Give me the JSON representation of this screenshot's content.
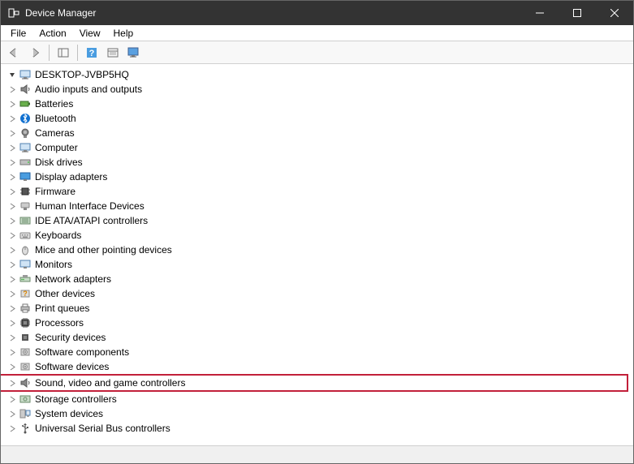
{
  "window": {
    "title": "Device Manager"
  },
  "menu": {
    "items": [
      "File",
      "Action",
      "View",
      "Help"
    ]
  },
  "toolbar": {
    "buttons": [
      {
        "name": "back",
        "icon": "arrow-left"
      },
      {
        "name": "forward",
        "icon": "arrow-right"
      },
      {
        "name": "show-hide-tree",
        "icon": "panel"
      },
      {
        "name": "help",
        "icon": "help"
      },
      {
        "name": "properties",
        "icon": "properties"
      },
      {
        "name": "scan",
        "icon": "monitor-scan"
      }
    ]
  },
  "tree": {
    "root": {
      "label": "DESKTOP-JVBP5HQ",
      "icon": "computer",
      "expanded": true,
      "children": [
        {
          "label": "Audio inputs and outputs",
          "icon": "speaker"
        },
        {
          "label": "Batteries",
          "icon": "battery"
        },
        {
          "label": "Bluetooth",
          "icon": "bluetooth"
        },
        {
          "label": "Cameras",
          "icon": "camera"
        },
        {
          "label": "Computer",
          "icon": "computer"
        },
        {
          "label": "Disk drives",
          "icon": "disk"
        },
        {
          "label": "Display adapters",
          "icon": "display"
        },
        {
          "label": "Firmware",
          "icon": "chip"
        },
        {
          "label": "Human Interface Devices",
          "icon": "hid"
        },
        {
          "label": "IDE ATA/ATAPI controllers",
          "icon": "ide"
        },
        {
          "label": "Keyboards",
          "icon": "keyboard"
        },
        {
          "label": "Mice and other pointing devices",
          "icon": "mouse"
        },
        {
          "label": "Monitors",
          "icon": "monitor"
        },
        {
          "label": "Network adapters",
          "icon": "network"
        },
        {
          "label": "Other devices",
          "icon": "other"
        },
        {
          "label": "Print queues",
          "icon": "printer"
        },
        {
          "label": "Processors",
          "icon": "cpu"
        },
        {
          "label": "Security devices",
          "icon": "security"
        },
        {
          "label": "Software components",
          "icon": "software"
        },
        {
          "label": "Software devices",
          "icon": "software"
        },
        {
          "label": "Sound, video and game controllers",
          "icon": "speaker",
          "highlight": true
        },
        {
          "label": "Storage controllers",
          "icon": "storage"
        },
        {
          "label": "System devices",
          "icon": "system"
        },
        {
          "label": "Universal Serial Bus controllers",
          "icon": "usb"
        }
      ]
    }
  }
}
